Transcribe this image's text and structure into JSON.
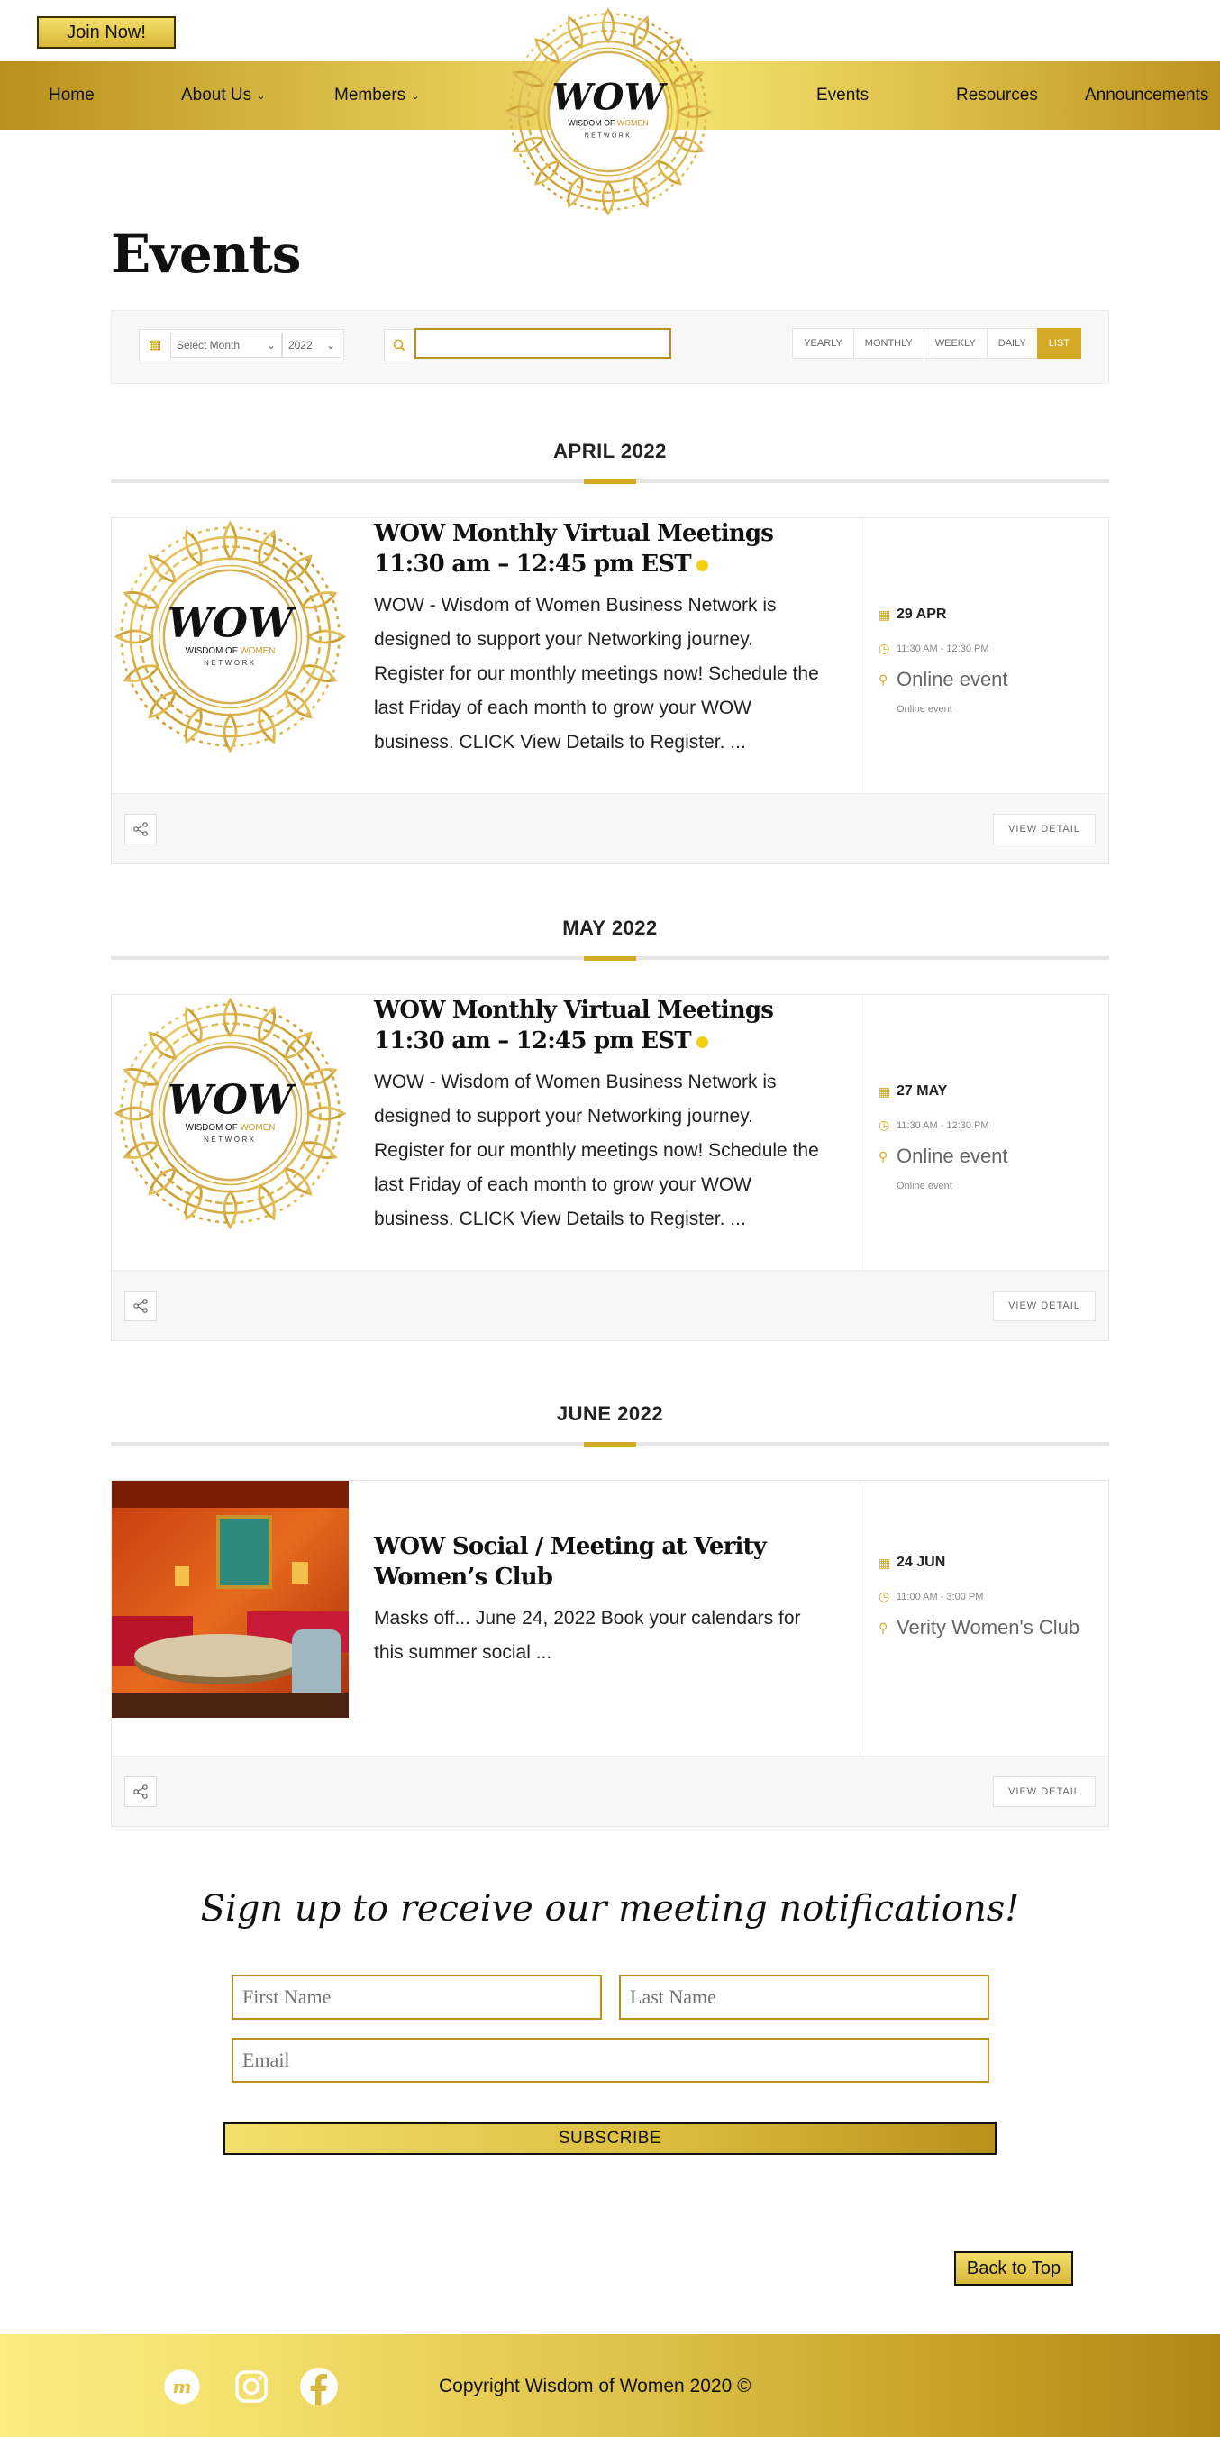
{
  "header": {
    "join_label": "Join Now!",
    "nav": {
      "home": "Home",
      "about": "About Us",
      "members": "Members",
      "events": "Events",
      "resources": "Resources",
      "announcements": "Announcements"
    },
    "logo": {
      "wordmark": "WOW",
      "line1a": "WISDOM OF ",
      "line1b": "WOMEN",
      "line2": "NETWORK"
    }
  },
  "page_title": "Events",
  "filters": {
    "month_select": "Select Month",
    "year_select": "2022",
    "search_value": "",
    "views": [
      "YEARLY",
      "MONTHLY",
      "WEEKLY",
      "DAILY",
      "LIST"
    ],
    "active_view": "LIST"
  },
  "months": [
    {
      "label": "APRIL 2022",
      "event": {
        "title": "WOW Monthly Virtual Meetings 11:30 am – 12:45 pm EST",
        "description": "WOW - Wisdom of Women Business Network is designed to support your Networking journey. Register for our monthly meetings now! Schedule the last Friday of each month to grow your WOW business. CLICK View Details to Register. ...",
        "date": "29 APR",
        "time": "11:30 AM - 12:30 PM",
        "location": "Online event",
        "location_sub": "Online event",
        "detail_label": "VIEW DETAIL"
      }
    },
    {
      "label": "MAY 2022",
      "event": {
        "title": "WOW Monthly Virtual Meetings 11:30 am – 12:45 pm EST",
        "description": "WOW - Wisdom of Women Business Network is designed to support your Networking journey. Register for our monthly meetings now! Schedule the last Friday of each month to grow your WOW business. CLICK View Details to Register. ...",
        "date": "27 MAY",
        "time": "11:30 AM - 12:30 PM",
        "location": "Online event",
        "location_sub": "Online event",
        "detail_label": "VIEW DETAIL"
      }
    },
    {
      "label": "JUNE 2022",
      "event": {
        "title": "WOW Social / Meeting at Verity Women’s Club",
        "description": "Masks off... June 24, 2022 Book your calendars for this summer social ...",
        "date": "24 JUN",
        "time": "11:00 AM - 3:00 PM",
        "location": "Verity Women's Club",
        "detail_label": "VIEW DETAIL"
      }
    }
  ],
  "signup": {
    "title": "Sign up to receive our meeting notifications!",
    "first_name_placeholder": "First Name",
    "last_name_placeholder": "Last Name",
    "email_placeholder": "Email",
    "subscribe_label": "SUBSCRIBE"
  },
  "back_to_top_label": "Back to Top",
  "footer": {
    "copyright": "Copyright Wisdom of Women 2020 ©",
    "social_icons": [
      "meetup-icon",
      "instagram-icon",
      "facebook-icon"
    ]
  },
  "colors": {
    "gold": "#d4aa24",
    "dark_gold": "#b8901b",
    "light_gold": "#f3df6b"
  }
}
